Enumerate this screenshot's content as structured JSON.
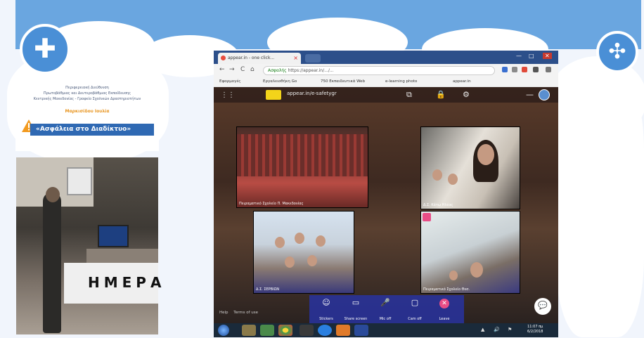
{
  "left_logo_glyph": "✚",
  "right_logo_glyph": "✣",
  "info": {
    "line1": "Περιφερειακή Διεύθυνση",
    "line2": "Πρωτοβάθμιας και Δευτεροβάθμιας Εκπαίδευσης",
    "line3": "Κεντρικής Μακεδονίας - Γραφείο Σχολικών Δραστηριοτήτων",
    "highlight": "Μαρκισίδου Ιουλία",
    "button_label": "«Ασφάλεια στο Διαδίκτυο»"
  },
  "photo_sign": "ΗΜΕΡΑ",
  "browser": {
    "tab_title": "appear.in - one click...",
    "tab_close": "×",
    "window_controls": [
      "—",
      "□",
      "✕"
    ],
    "nav": [
      "←",
      "→",
      "C",
      "⌂"
    ],
    "security_label": "Ασφαλής",
    "url": "https://appear.in/.../...",
    "bookmarks": [
      "Εφαρμογές",
      "Εργαλειοθήκη Go",
      "750 Εκπαιδευτικά Web",
      "e-learning photo"
    ],
    "bookmark_last": "appear.in"
  },
  "room": {
    "grid_icon": "⋮⋮",
    "name": "appear.in/e-safetygr",
    "top_icons": [
      "⧉",
      "🔒",
      "⚙"
    ],
    "minimize": "—",
    "tiles": [
      {
        "label": "Πειραματικό Σχολείο Π. Μακεδονίας"
      },
      {
        "label": "Δ.Σ. Κάτω Ηλέας"
      },
      {
        "label": "Δ.Σ. ΣΕΡΒΙΩΝ"
      },
      {
        "label": "Πειραματικό Σχολείο Θεσ."
      }
    ],
    "toolbar": [
      {
        "icon": "☺",
        "label": "Stickers"
      },
      {
        "icon": "▭",
        "label": "Share screen"
      },
      {
        "icon": "🎤",
        "label": "Mic off"
      },
      {
        "icon": "▢",
        "label": "Cam off"
      },
      {
        "icon": "✕",
        "label": "Leave"
      }
    ],
    "footer_help": "Help",
    "footer_terms": "Terms of use",
    "chat_icon": "💬"
  },
  "taskbar": {
    "clock_time": "11:07 πμ",
    "clock_date": "6/2/2018",
    "tray": [
      "▲",
      "🔊",
      "⚑"
    ]
  },
  "colors": {
    "banner": "#6aa6e0",
    "info_button": "#2f69b3",
    "leave": "#e84d86",
    "toolbar": "#2832a0"
  }
}
